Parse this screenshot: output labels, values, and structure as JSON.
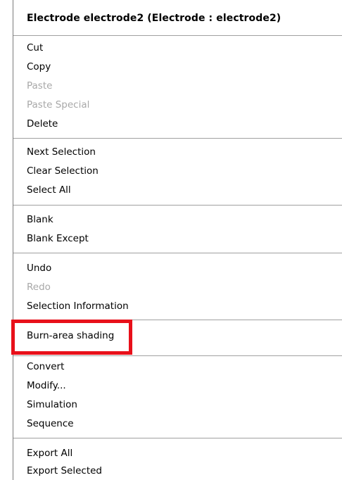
{
  "menu": {
    "title": "Electrode electrode2 (Electrode : electrode2)",
    "groups": [
      [
        {
          "label": "Cut",
          "enabled": true
        },
        {
          "label": "Copy",
          "enabled": true
        },
        {
          "label": "Paste",
          "enabled": false
        },
        {
          "label": "Paste Special",
          "enabled": false
        },
        {
          "label": "Delete",
          "enabled": true
        }
      ],
      [
        {
          "label": "Next Selection",
          "enabled": true
        },
        {
          "label": "Clear Selection",
          "enabled": true
        },
        {
          "label": "Select All",
          "enabled": true
        }
      ],
      [
        {
          "label": "Blank",
          "enabled": true
        },
        {
          "label": "Blank Except",
          "enabled": true
        }
      ],
      [
        {
          "label": "Undo",
          "enabled": true
        },
        {
          "label": "Redo",
          "enabled": false
        },
        {
          "label": "Selection Information",
          "enabled": true
        }
      ],
      [
        {
          "label": "Burn-area shading",
          "enabled": true,
          "highlighted": true
        }
      ],
      [
        {
          "label": "Convert",
          "enabled": true
        },
        {
          "label": "Modify...",
          "enabled": true
        },
        {
          "label": "Simulation",
          "enabled": true
        },
        {
          "label": "Sequence",
          "enabled": true
        }
      ],
      [
        {
          "label": "Export All",
          "enabled": true
        },
        {
          "label": "Export Selected",
          "enabled": true
        }
      ]
    ]
  },
  "colors": {
    "highlight_box": "#e8101a",
    "disabled_text": "#a8a8a8",
    "separator": "#a0a0a0"
  }
}
